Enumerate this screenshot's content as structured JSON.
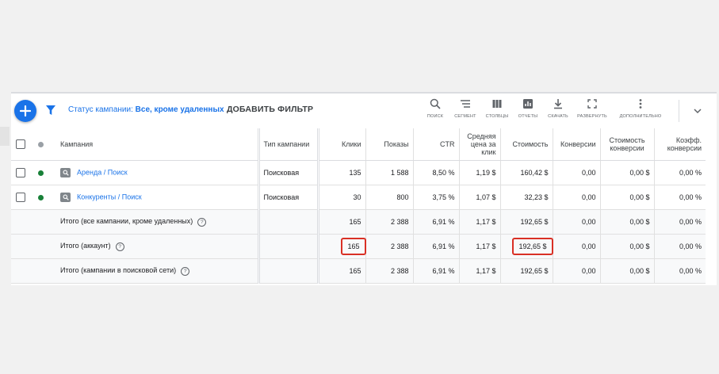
{
  "toolbar": {
    "filter_status_label": "Статус кампании:",
    "filter_status_value": "Все, кроме удаленных",
    "add_filter": "ДОБАВИТЬ ФИЛЬТР",
    "tools": [
      {
        "label": "ПОИСК",
        "icon": "search-icon"
      },
      {
        "label": "СЕГМЕНТ",
        "icon": "segment-icon"
      },
      {
        "label": "СТОЛБЦЫ",
        "icon": "columns-icon"
      },
      {
        "label": "ОТЧЕТЫ",
        "icon": "reports-icon"
      },
      {
        "label": "СКАЧАТЬ",
        "icon": "download-icon"
      },
      {
        "label": "РАЗВЕРНУТЬ",
        "icon": "expand-icon"
      },
      {
        "label": "ДОПОЛНИТЕЛЬНО",
        "icon": "more-icon"
      }
    ]
  },
  "table": {
    "headers": {
      "campaign": "Кампания",
      "type": "Тип кампании",
      "clicks": "Клики",
      "impressions": "Показы",
      "ctr": "CTR",
      "avg_cpc": "Средняя цена за клик",
      "cost": "Стоимость",
      "conversions": "Конверсии",
      "cost_per_conv": "Стоимость конверсии",
      "conv_rate": "Коэфф. конверсии"
    },
    "rows": [
      {
        "name": "Аренда / Поиск",
        "type": "Поисковая",
        "clicks": "135",
        "impressions": "1 588",
        "ctr": "8,50 %",
        "avg_cpc": "1,19 $",
        "cost": "160,42 $",
        "conversions": "0,00",
        "cost_per_conv": "0,00 $",
        "conv_rate": "0,00 %",
        "status_color": "#188038"
      },
      {
        "name": "Конкуренты / Поиск",
        "type": "Поисковая",
        "clicks": "30",
        "impressions": "800",
        "ctr": "3,75 %",
        "avg_cpc": "1,07 $",
        "cost": "32,23 $",
        "conversions": "0,00",
        "cost_per_conv": "0,00 $",
        "conv_rate": "0,00 %",
        "status_color": "#188038"
      }
    ],
    "totals": [
      {
        "label": "Итого (все кампании, кроме удаленных)",
        "clicks": "165",
        "impressions": "2 388",
        "ctr": "6,91 %",
        "avg_cpc": "1,17 $",
        "cost": "192,65 $",
        "conversions": "0,00",
        "cost_per_conv": "0,00 $",
        "conv_rate": "0,00 %"
      },
      {
        "label": "Итого (аккаунт)",
        "clicks": "165",
        "impressions": "2 388",
        "ctr": "6,91 %",
        "avg_cpc": "1,17 $",
        "cost": "192,65 $",
        "conversions": "0,00",
        "cost_per_conv": "0,00 $",
        "conv_rate": "0,00 %"
      },
      {
        "label": "Итого (кампании в поисковой сети)",
        "clicks": "165",
        "impressions": "2 388",
        "ctr": "6,91 %",
        "avg_cpc": "1,17 $",
        "cost": "192,65 $",
        "conversions": "0,00",
        "cost_per_conv": "0,00 $",
        "conv_rate": "0,00 %"
      }
    ],
    "help_glyph": "?"
  },
  "colors": {
    "accent": "#1a73e8",
    "highlight": "#d93025",
    "enabled": "#188038"
  }
}
